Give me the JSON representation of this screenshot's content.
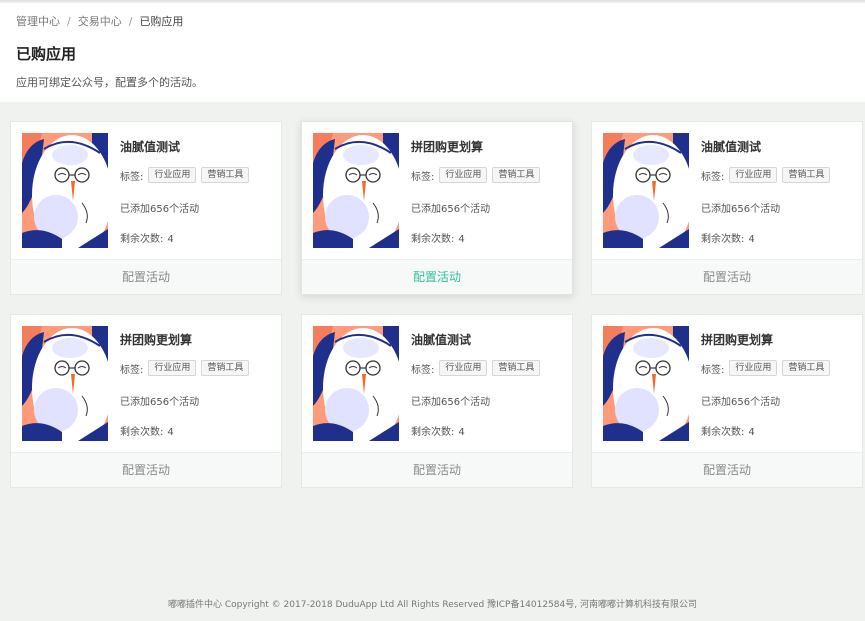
{
  "breadcrumb": {
    "items": [
      "管理中心",
      "交易中心",
      "已购应用"
    ],
    "separator": "/"
  },
  "page": {
    "title": "已购应用",
    "description": "应用可绑定公众号，配置多个的活动。"
  },
  "card_labels": {
    "tag_prefix": "标签:",
    "remain_prefix": "剩余次数:"
  },
  "cards": [
    {
      "name": "油腻值测试",
      "tags": [
        "行业应用",
        "营销工具"
      ],
      "count_text": "已添加656个活动",
      "remain": "4",
      "action": "配置活动",
      "active": false
    },
    {
      "name": "拼团购更划算",
      "tags": [
        "行业应用",
        "营销工具"
      ],
      "count_text": "已添加656个活动",
      "remain": "4",
      "action": "配置活动",
      "active": true
    },
    {
      "name": "油腻值测试",
      "tags": [
        "行业应用",
        "营销工具"
      ],
      "count_text": "已添加656个活动",
      "remain": "4",
      "action": "配置活动",
      "active": false
    },
    {
      "name": "拼团购更划算",
      "tags": [
        "行业应用",
        "营销工具"
      ],
      "count_text": "已添加656个活动",
      "remain": "4",
      "action": "配置活动",
      "active": false
    },
    {
      "name": "油腻值测试",
      "tags": [
        "行业应用",
        "营销工具"
      ],
      "count_text": "已添加656个活动",
      "remain": "4",
      "action": "配置活动",
      "active": false
    },
    {
      "name": "拼团购更划算",
      "tags": [
        "行业应用",
        "营销工具"
      ],
      "count_text": "已添加656个活动",
      "remain": "4",
      "action": "配置活动",
      "active": false
    }
  ],
  "footer": {
    "text": "嘟嘟插件中心 Copyright © 2017-2018  DuduApp Ltd All Rights Reserved 豫ICP备14012584号, 河南嘟嘟计算机科技有限公司"
  },
  "colors": {
    "accent": "#2ec49b",
    "page_bg": "#f0f2f0",
    "card_bg": "#ffffff"
  }
}
